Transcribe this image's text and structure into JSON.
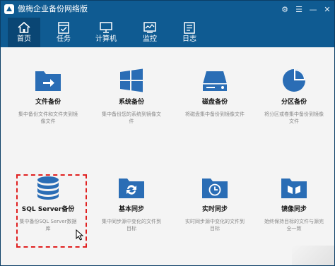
{
  "app": {
    "title": "傲梅企业备份网络版"
  },
  "window_controls": {
    "settings": "⚙",
    "menu": "☰",
    "minimize": "—",
    "close": "✕"
  },
  "toolbar": [
    {
      "label": "首页",
      "icon": "home-icon"
    },
    {
      "label": "任务",
      "icon": "task-icon"
    },
    {
      "label": "计算机",
      "icon": "computer-icon"
    },
    {
      "label": "监控",
      "icon": "monitor-icon"
    },
    {
      "label": "日志",
      "icon": "log-icon"
    }
  ],
  "tiles": [
    {
      "title": "文件备份",
      "desc": "集中备份文件和文件夹到镜像文件",
      "icon": "folder-arrow-icon"
    },
    {
      "title": "系统备份",
      "desc": "集中备份您的系统到镜像文件",
      "icon": "windows-icon"
    },
    {
      "title": "磁盘备份",
      "desc": "将磁盘集中备份到镜像文件",
      "icon": "disk-icon"
    },
    {
      "title": "分区备份",
      "desc": "将分区或卷集中备份到镜像文件",
      "icon": "pie-icon"
    },
    {
      "title": "SQL Server备份",
      "desc": "集中备份SQL Server数据库",
      "icon": "database-icon"
    },
    {
      "title": "基本同步",
      "desc": "集中同步源中变化的文件到目标",
      "icon": "sync-folder-icon"
    },
    {
      "title": "实时同步",
      "desc": "实时同步源中变化的文件到目标",
      "icon": "clock-folder-icon"
    },
    {
      "title": "镜像同步",
      "desc": "始终保持目标的文件与源完全一致",
      "icon": "mirror-folder-icon"
    }
  ],
  "colors": {
    "accent": "#0f5b92",
    "icon_blue": "#2a6db5",
    "selection": "#e02020"
  }
}
